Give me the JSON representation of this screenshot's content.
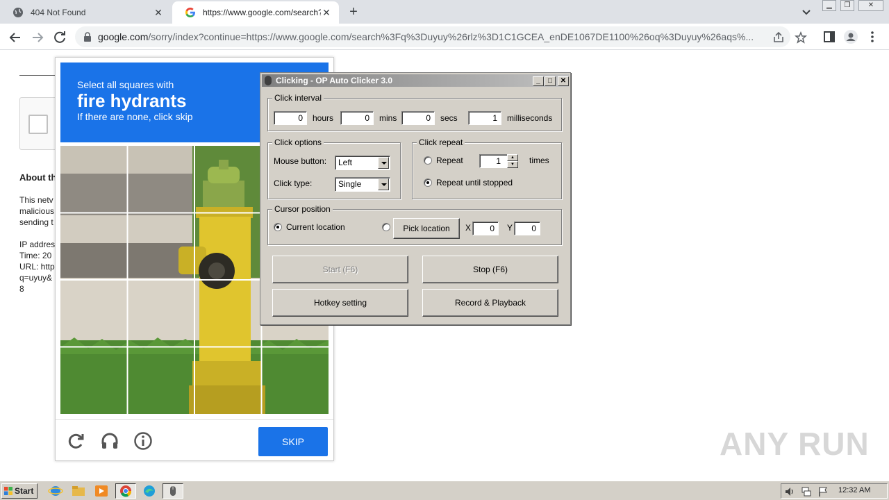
{
  "browser": {
    "tabs": [
      {
        "title": "404 Not Found",
        "active": false
      },
      {
        "title": "https://www.google.com/search?q=",
        "active": true
      }
    ],
    "url_host": "google.com",
    "url_path": "/sorry/index?continue=https://www.google.com/search%3Fq%3Duyuy%26rlz%3D1C1GCEA_enDE1067DE1100%26oq%3Duyuy%26aqs%..."
  },
  "page": {
    "heading": "About th",
    "para1": [
      "This netv",
      "malicious",
      "sending t"
    ],
    "para2": [
      "IP addres",
      "Time: 20",
      "URL: http",
      "q=uyuy&",
      "8"
    ]
  },
  "captcha": {
    "line1": "Select all squares with",
    "line2": "fire hydrants",
    "line3": "If there are none, click skip",
    "skip_label": "SKIP"
  },
  "clicker": {
    "title": "Clicking - OP Auto Clicker 3.0",
    "interval": {
      "label": "Click interval",
      "hours": "0",
      "hours_label": "hours",
      "mins": "0",
      "mins_label": "mins",
      "secs": "0",
      "secs_label": "secs",
      "ms": "1",
      "ms_label": "milliseconds"
    },
    "options": {
      "label": "Click options",
      "mouse_label": "Mouse button:",
      "mouse_value": "Left",
      "type_label": "Click type:",
      "type_value": "Single"
    },
    "repeat": {
      "label": "Click repeat",
      "repeat_label": "Repeat",
      "repeat_count": "1",
      "times_label": "times",
      "until_label": "Repeat until stopped"
    },
    "cursor": {
      "label": "Cursor position",
      "current_label": "Current location",
      "pick_label": "Pick location",
      "x_label": "X",
      "x": "0",
      "y_label": "Y",
      "y": "0"
    },
    "buttons": {
      "start": "Start (F6)",
      "stop": "Stop (F6)",
      "hotkey": "Hotkey setting",
      "record": "Record & Playback"
    }
  },
  "watermark": "ANY RUN",
  "taskbar": {
    "start_label": "Start",
    "clock": "12:32 AM"
  }
}
